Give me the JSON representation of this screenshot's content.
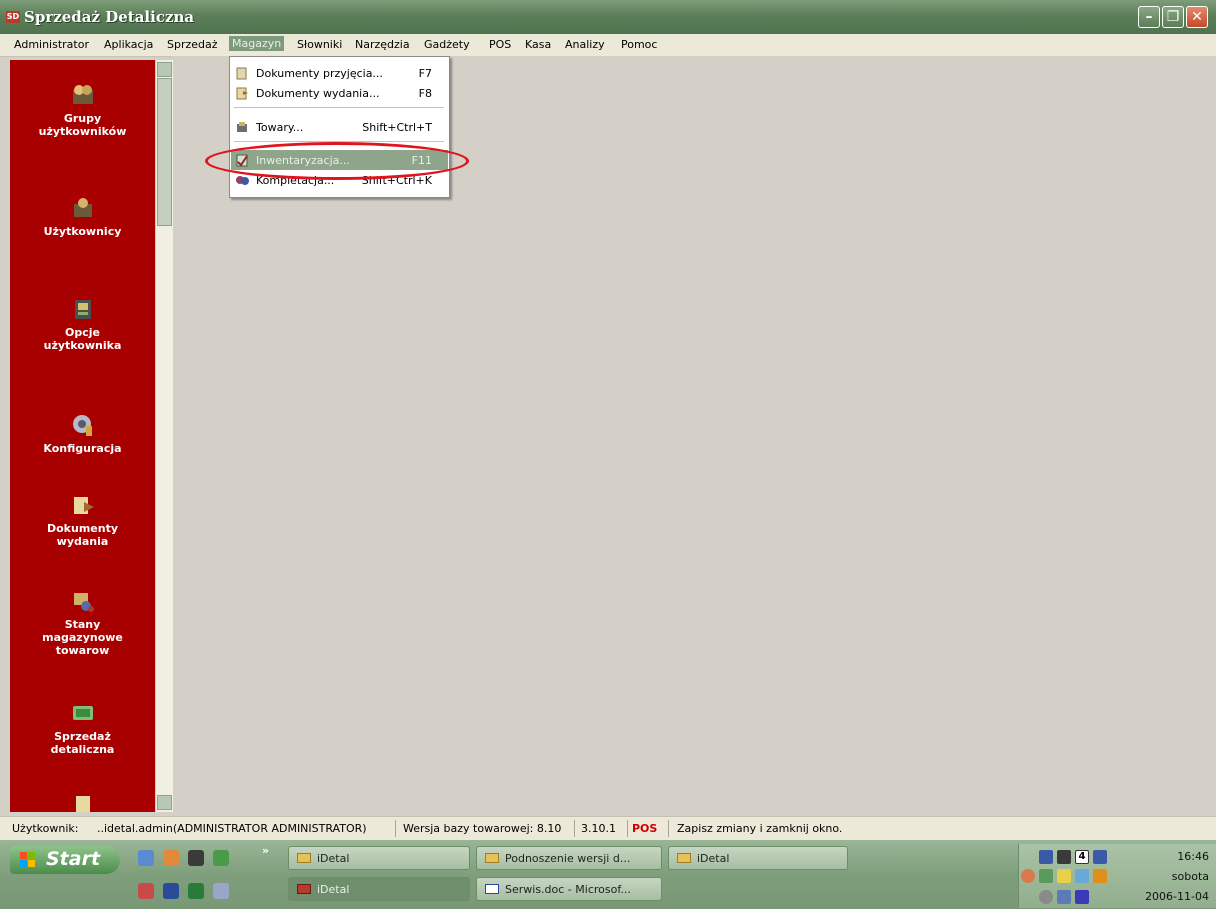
{
  "window": {
    "title": "Sprzedaż Detaliczna",
    "icon_text": "SD"
  },
  "menubar": [
    "Administrator",
    "Aplikacja",
    "Sprzedaż",
    "Magazyn",
    "Słowniki",
    "Narzędzia",
    "Gadżety",
    "POS",
    "Kasa",
    "Analizy",
    "Pomoc"
  ],
  "magazyn_menu": [
    {
      "label": "Dokumenty przyjęcia...",
      "shortcut": "F7"
    },
    {
      "label": "Dokumenty wydania...",
      "shortcut": "F8"
    },
    {
      "label": "Towary...",
      "shortcut": "Shift+Ctrl+T"
    },
    {
      "label": "Inwentaryzacja...",
      "shortcut": "F11"
    },
    {
      "label": "Kompletacja...",
      "shortcut": "Shift+Ctrl+K"
    }
  ],
  "sidebar": [
    {
      "line1": "Grupy",
      "line2": "użytkowników",
      "line3": ""
    },
    {
      "line1": "Użytkownicy",
      "line2": "",
      "line3": ""
    },
    {
      "line1": "Opcje",
      "line2": "użytkownika",
      "line3": ""
    },
    {
      "line1": "Konfiguracja",
      "line2": "",
      "line3": ""
    },
    {
      "line1": "Dokumenty",
      "line2": "wydania",
      "line3": ""
    },
    {
      "line1": "Stany",
      "line2": "magazynowe",
      "line3": "towarow"
    },
    {
      "line1": "Sprzedaż",
      "line2": "detaliczna",
      "line3": ""
    }
  ],
  "statusbar": {
    "user_label": "Użytkownik:",
    "user_value": "..idetal.admin(ADMINISTRATOR ADMINISTRATOR)",
    "db_version": "Wersja bazy towarowej: 8.10",
    "app_version": "3.10.1",
    "pos": "POS",
    "hint": "Zapisz zmiany i zamknij okno."
  },
  "taskbar": {
    "start": "Start",
    "chevron": "»",
    "row1": [
      "iDetal",
      "Podnoszenie wersji d...",
      "iDetal"
    ],
    "row2": [
      "iDetal",
      "Serwis.doc - Microsof..."
    ],
    "clock_time": "16:46",
    "clock_day": "sobota",
    "clock_date": "2006-11-04",
    "tray_number": "4"
  },
  "colors": {
    "sidebar": "#a80000",
    "highlight": "#8ea58b",
    "title": "#5c7f58",
    "annotation": "#e0141c"
  }
}
